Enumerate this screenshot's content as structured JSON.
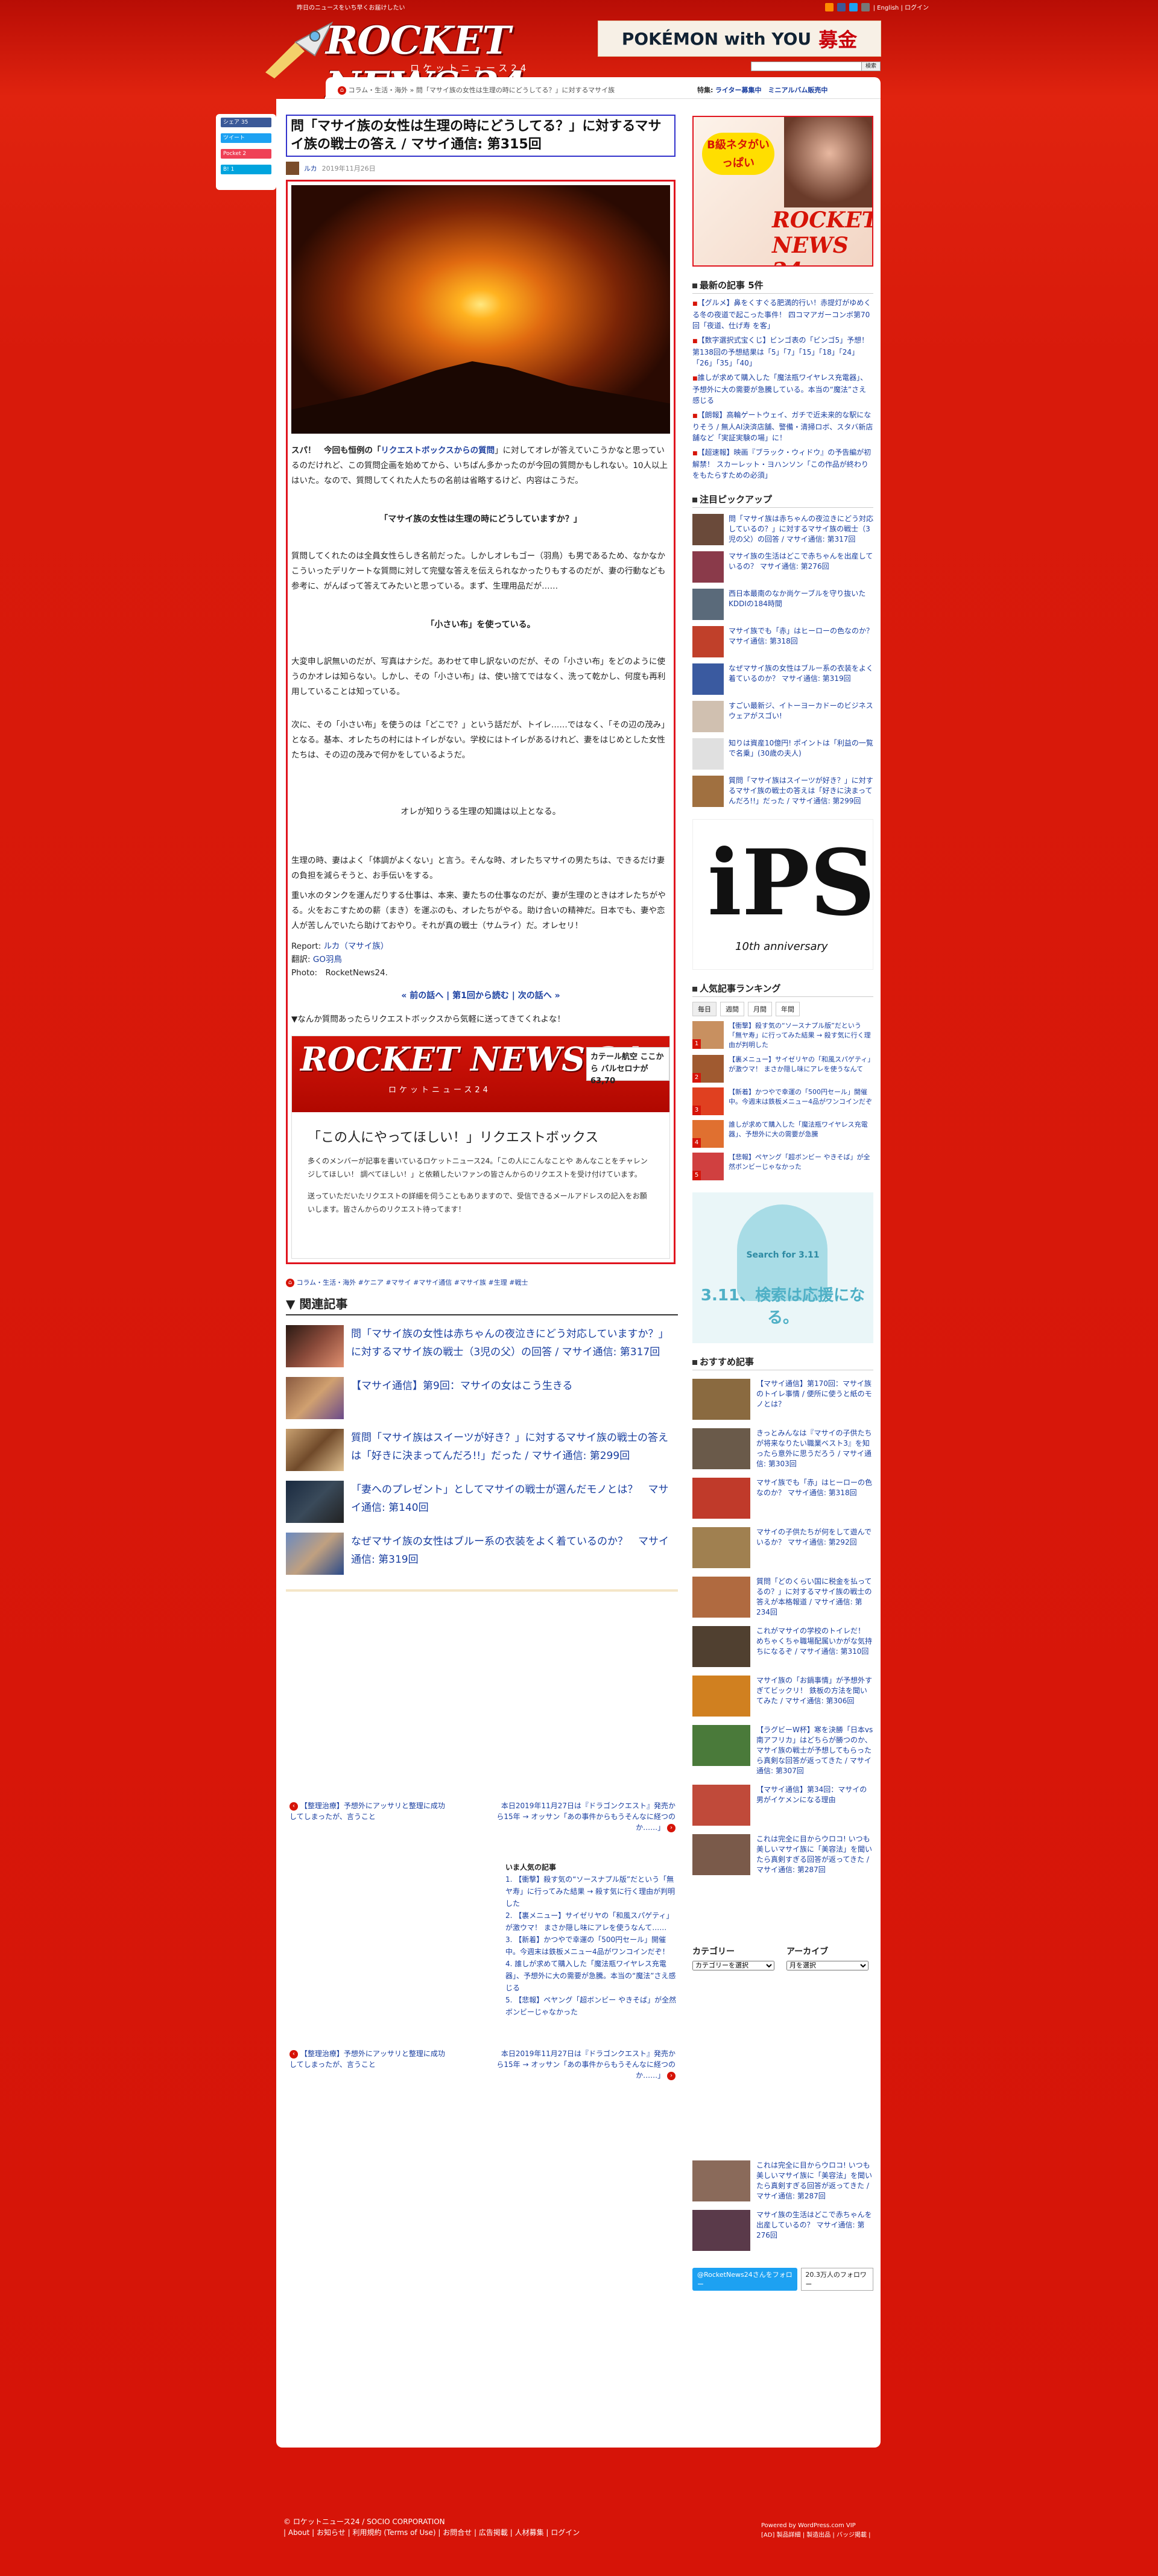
{
  "topbar": {
    "tagline": "昨日のニュースをいち早くお届けしたい",
    "lang_links": "| English | ログイン"
  },
  "logo": {
    "text": "ROCKET NEWS 24",
    "sub": "ロケットニュース24"
  },
  "header_ad": {
    "text": "POKÉMON with YOU",
    "red": "募金"
  },
  "search": {
    "button": "検索"
  },
  "breadcrumb": "コラム・生活・海外 » 問「マサイ族の女性は生理の時にどうしてる？」に対するマサイ族",
  "special": {
    "label": "特集:",
    "links": "ライター募集中　ミニアルバム販売中"
  },
  "share": [
    "シェア 35",
    "ツイート",
    "Pocket 2",
    "B! 1"
  ],
  "article": {
    "title": "問「マサイ族の女性は生理の時にどうしてる？」に対するマサイ族の戦士の答え / マサイ通信: 第315回",
    "author": "ルカ",
    "date": "2019年11月26日",
    "p1_lead": "スパ！　今回も恒例の「",
    "p1_link": "リクエストボックスからの質問",
    "p1_rest": "」に対してオレが答えていこうかなと思っているのだけれど、この質問企画を始めてから、いちばん多かったのが今回の質問かもしれない。10人以上はいた。なので、質問してくれた人たちの名前は省略するけど、内容はこうだ。",
    "q1": "「マサイ族の女性は生理の時にどうしていますか？」",
    "p2": "質問してくれたのは全員女性らしき名前だった。しかしオレもゴー（羽鳥）も男であるため、なかなかこういったデリケートな質問に対して完璧な答えを伝えられなかったりもするのだが、妻の行動なども参考に、がんばって答えてみたいと思っている。まず、生理用品だが……",
    "q2": "「小さい布」を使っている。",
    "p3": "大変申し訳無いのだが、写真はナシだ。あわせて申し訳ないのだが、その「小さい布」をどのように使うのかオレは知らない。しかし、その「小さい布」は、使い捨てではなく、洗って乾かし、何度も再利用していることは知っている。",
    "p4": "次に、その「小さい布」を使うのは「どこで？」という話だが、トイレ……ではなく、「その辺の茂み」となる。基本、オレたちの村にはトイレがない。学校にはトイレがあるけれど、妻をはじめとした女性たちは、その辺の茂みで何かをしているようだ。",
    "q3": "オレが知りうる生理の知識は以上となる。",
    "p5": "生理の時、妻はよく「体調がよくない」と言う。そんな時、オレたちマサイの男たちは、できるだけ妻の負担を減らそうと、お手伝いをする。",
    "p6": "重い水のタンクを運んだりする仕事は、本来、妻たちの仕事なのだが、妻が生理のときはオレたちがやる。火をおこすための薪（まき）を運ぶのも、オレたちがやる。助け合いの精神だ。日本でも、妻や恋人が苦しんでいたら助けておやり。それが真の戦士（サムライ）だ。オレセリ！",
    "report_label": "Report:",
    "report_name": "ルカ（マサイ族）",
    "trans_label": "翻訳:",
    "trans_name": "GO羽鳥",
    "photo": "Photo:　RocketNews24.",
    "pagination": "« 前の話へ | 第1回から読む | 次の話へ »",
    "request_lead": "▼なんか質問あったらリクエストボックスから気軽に送ってきてくれよな！"
  },
  "request_card": {
    "logo": "ROCKET NEWS 24",
    "logo_sub": "ロケットニュース24",
    "ad": "カテール航空 ここから バルセロナが63,70",
    "title": "「この人にやってほしい！」リクエストボックス",
    "text1": "多くのメンバーが記事を書いているロケットニュース24。「この人にこんなことや あんなことをチャレンジしてほしい！ 調べてほしい！」と依頼したいファンの皆さんからのリクエストを受け付けています。",
    "text2": "送っていただいたリクエストの詳細を伺うこともありますので、受信できるメールアドレスの記入をお願いします。皆さんからのリクエスト待ってます！"
  },
  "tags": "コラム・生活・海外 #ケニア #マサイ #マサイ通信 #マサイ族 #生理 #戦士",
  "related": {
    "heading": "▼ 関連記事",
    "items": [
      "問「マサイ族の女性は赤ちゃんの夜泣きにどう対応していますか？」に対するマサイ族の戦士（3児の父）の回答 / マサイ通信: 第317回",
      "【マサイ通信】第9回：マサイの女はこう生きる",
      "質問「マサイ族はスイーツが好き？」に対するマサイ族の戦士の答えは「好きに決まってんだろ!!」だった / マサイ通信: 第299回",
      "「妻へのプレゼント」としてマサイの戦士が選んだモノとは？　マサイ通信: 第140回",
      "なぜマサイ族の女性はブルー系の衣装をよく着ているのか？　マサイ通信: 第319回"
    ]
  },
  "prev_next": {
    "left": "【整理治療】予想外にアッサリと整理に成功してしまったが、言うこと",
    "right": "本日2019年11月27日は『ドラゴンクエスト』発売から15年 → オッサン「あの事件からもうそんなに経つのか……」"
  },
  "popular_mini": {
    "heading": "いま人気の記事",
    "items": [
      "1. 【衝撃】殺す気の“ソースナプル版”だという「無ヤ寿」に行ってみた結果 → 殺す気に行く理由が判明した",
      "2. 【裏メニュー】サイゼリヤの「和風スパゲティ」が激ウマ！ まさか隠し味にアレを使うなんて……",
      "3. 【新着】かつやで幸運の「500円セール」開催中。今週末は鉄板メニュー4品がワンコインだぞ！",
      "4. 誰しが求めて購入した「魔法瓶ワイヤレス充電器」、予想外に大の需要が急騰。本当の“魔法”さえ感じる",
      "5. 【悲報】ペヤング「超ボンビー やきそば」が全然ボンビーじゃなかった"
    ]
  },
  "sidebar": {
    "banner_bubble": "B級ネタがいっぱい",
    "banner_logo": "ROCKET NEWS 24",
    "latest_head": "最新の記事 5件",
    "latest": [
      "【グルメ】鼻をくすぐる肥満的行い！赤提灯がゆめくる冬の夜道で起こった事件！ 四コマアガーコンボ第70回「夜道、仕げ寿 を客」",
      "【数字選択式宝くじ】ビンゴ表の「ビンゴ5」予想！ 第138回の予想結果は「5」「7」「15」「18」「24」「26」「35」「40」",
      "誰しが求めて購入した「魔法瓶ワイヤレス充電器」、予想外に大の需要が急騰している。本当の“魔法”さえ感じる",
      "【朗報】高輪ゲートウェイ、ガチで近未来的な駅になりそう / 無人AI決済店舗、警備・清掃ロボ、スタバ新店舗など「実証実験の場」に！",
      "【超速報】映画『ブラック・ウィドウ』の予告編が初解禁！ スカーレット・ヨハンソン「この作品が終わりをもたらすための必須」"
    ],
    "pickup_head": "注目ピックアップ",
    "pickups": [
      "問「マサイ族は赤ちゃんの夜泣きにどう対応しているの？」に対するマサイ族の戦士（3児の父）の回答 / マサイ通信: 第317回",
      "マサイ族の生活はどこで赤ちゃんを出産しているの？ マサイ通信: 第276回",
      "西日本最南のなか尚ケーブルを守り抜いた KDDIの184時間",
      "マサイ族でも「赤」はヒーローの色なのか？ マサイ通信: 第318回",
      "なぜマサイ族の女性はブルー系の衣装をよく着ているのか？ マサイ通信: 第319回",
      "すごい最新ジ、イトーヨーカドーのビジネスウェアがスゴい!",
      "知りは資産10億円! ポイントは「利益の一覧で名乗」(30歳の夫人)",
      "質問「マサイ族はスイーツが好き？」に対するマサイ族の戦士の答えは「好きに決まってんだろ!!」だった / マサイ通信: 第299回"
    ],
    "ips_big": "iPS",
    "ips_sub": "10th anniversary",
    "ranking_head": "人気記事ランキング",
    "ranking_tabs": [
      "毎日",
      "週間",
      "月間",
      "年間"
    ],
    "ranking": [
      "【衝撃】殺す気の“ソースナプル版”だという「無ヤ寿」に行ってみた結果 → 殺す気に行く理由が判明した",
      "【裏メニュー】サイゼリヤの「和風スパゲティ」が激ウマ！ まさか隠し味にアレを使うなんて",
      "【新着】かつやで幸運の「500円セール」開催中。今週末は鉄板メニュー4品がワンコインだぞ",
      "誰しが求めて購入した「魔法瓶ワイヤレス充電器」、予想外に大の需要が急騰",
      "【悲報】ペヤング「超ボンビー やきそば」が全然ボンビーじゃなかった"
    ],
    "ad311_t1": "Search for 3.11",
    "ad311_t2": "3.11、検索は応援になる。",
    "rec_head": "おすすめ記事",
    "recs": [
      "【マサイ通信】第170回：マサイ族のトイレ事情 / 便所に使うと紙のモノとは？",
      "きっとみんなは『マサイの子供たちが将来なりたい職業ベスト3』を知ったら意外に思うだろう / マサイ通信: 第303回",
      "マサイ族でも「赤」はヒーローの色なのか？ マサイ通信: 第318回",
      "マサイの子供たちが何をして遊んでいるか？ マサイ通信: 第292回",
      "質問「どのくらい国に税金を払ってるの？」に対するマサイ族の戦士の答えが本格報道 / マサイ通信: 第234回",
      "これがマサイの学校のトイレだ！ めちゃくちゃ職場配属いかがな気持ちになるぞ / マサイ通信: 第310回",
      "マサイ族の「お鍋事情」が予想外すぎてビックリ！ 鉄板の方法を聞いてみた / マサイ通信: 第306回",
      "【ラグビーW杯】寒を決勝「日本vs南アフリカ」はどちらが勝つのか、マサイ族の戦士が予想してもらったら真剣な回答が返ってきた / マサイ通信: 第307回",
      "【マサイ通信】第34回：マサイの男がイケメンになる理由",
      "これは完全に目からウロコ! いつも美しいマサイ族に「美容法」を聞いたら真剣すぎる回答が返ってきた / マサイ通信: 第287回"
    ],
    "category_head": "カテゴリー",
    "archive_head": "アーカイブ",
    "category_select": "カテゴリーを選択",
    "archive_select": "月を選択",
    "bottom_recs": [
      "これは完全に目からウロコ! いつも美しいマサイ族に「美容法」を聞いたら真剣すぎる回答が返ってきた / マサイ通信: 第287回",
      "マサイ族の生活はどこで赤ちゃんを出産しているの？ マサイ通信: 第276回"
    ],
    "twitter_btn": "@RocketNews24さんをフォロー",
    "twitter_count": "20.3万人のフォロワー"
  },
  "footer": {
    "copyright": "© ロケットニュース24 / SOCIO CORPORATION",
    "links": "| About | お知らせ | 利用規約 (Terms of Use) | お問合せ | 広告掲載 | 人材募集 | ログイン",
    "powered": "Powered by WordPress.com VIP",
    "right_links": "[AD] 製品詳細 | 製造出品 | バッジ掲載 |"
  }
}
